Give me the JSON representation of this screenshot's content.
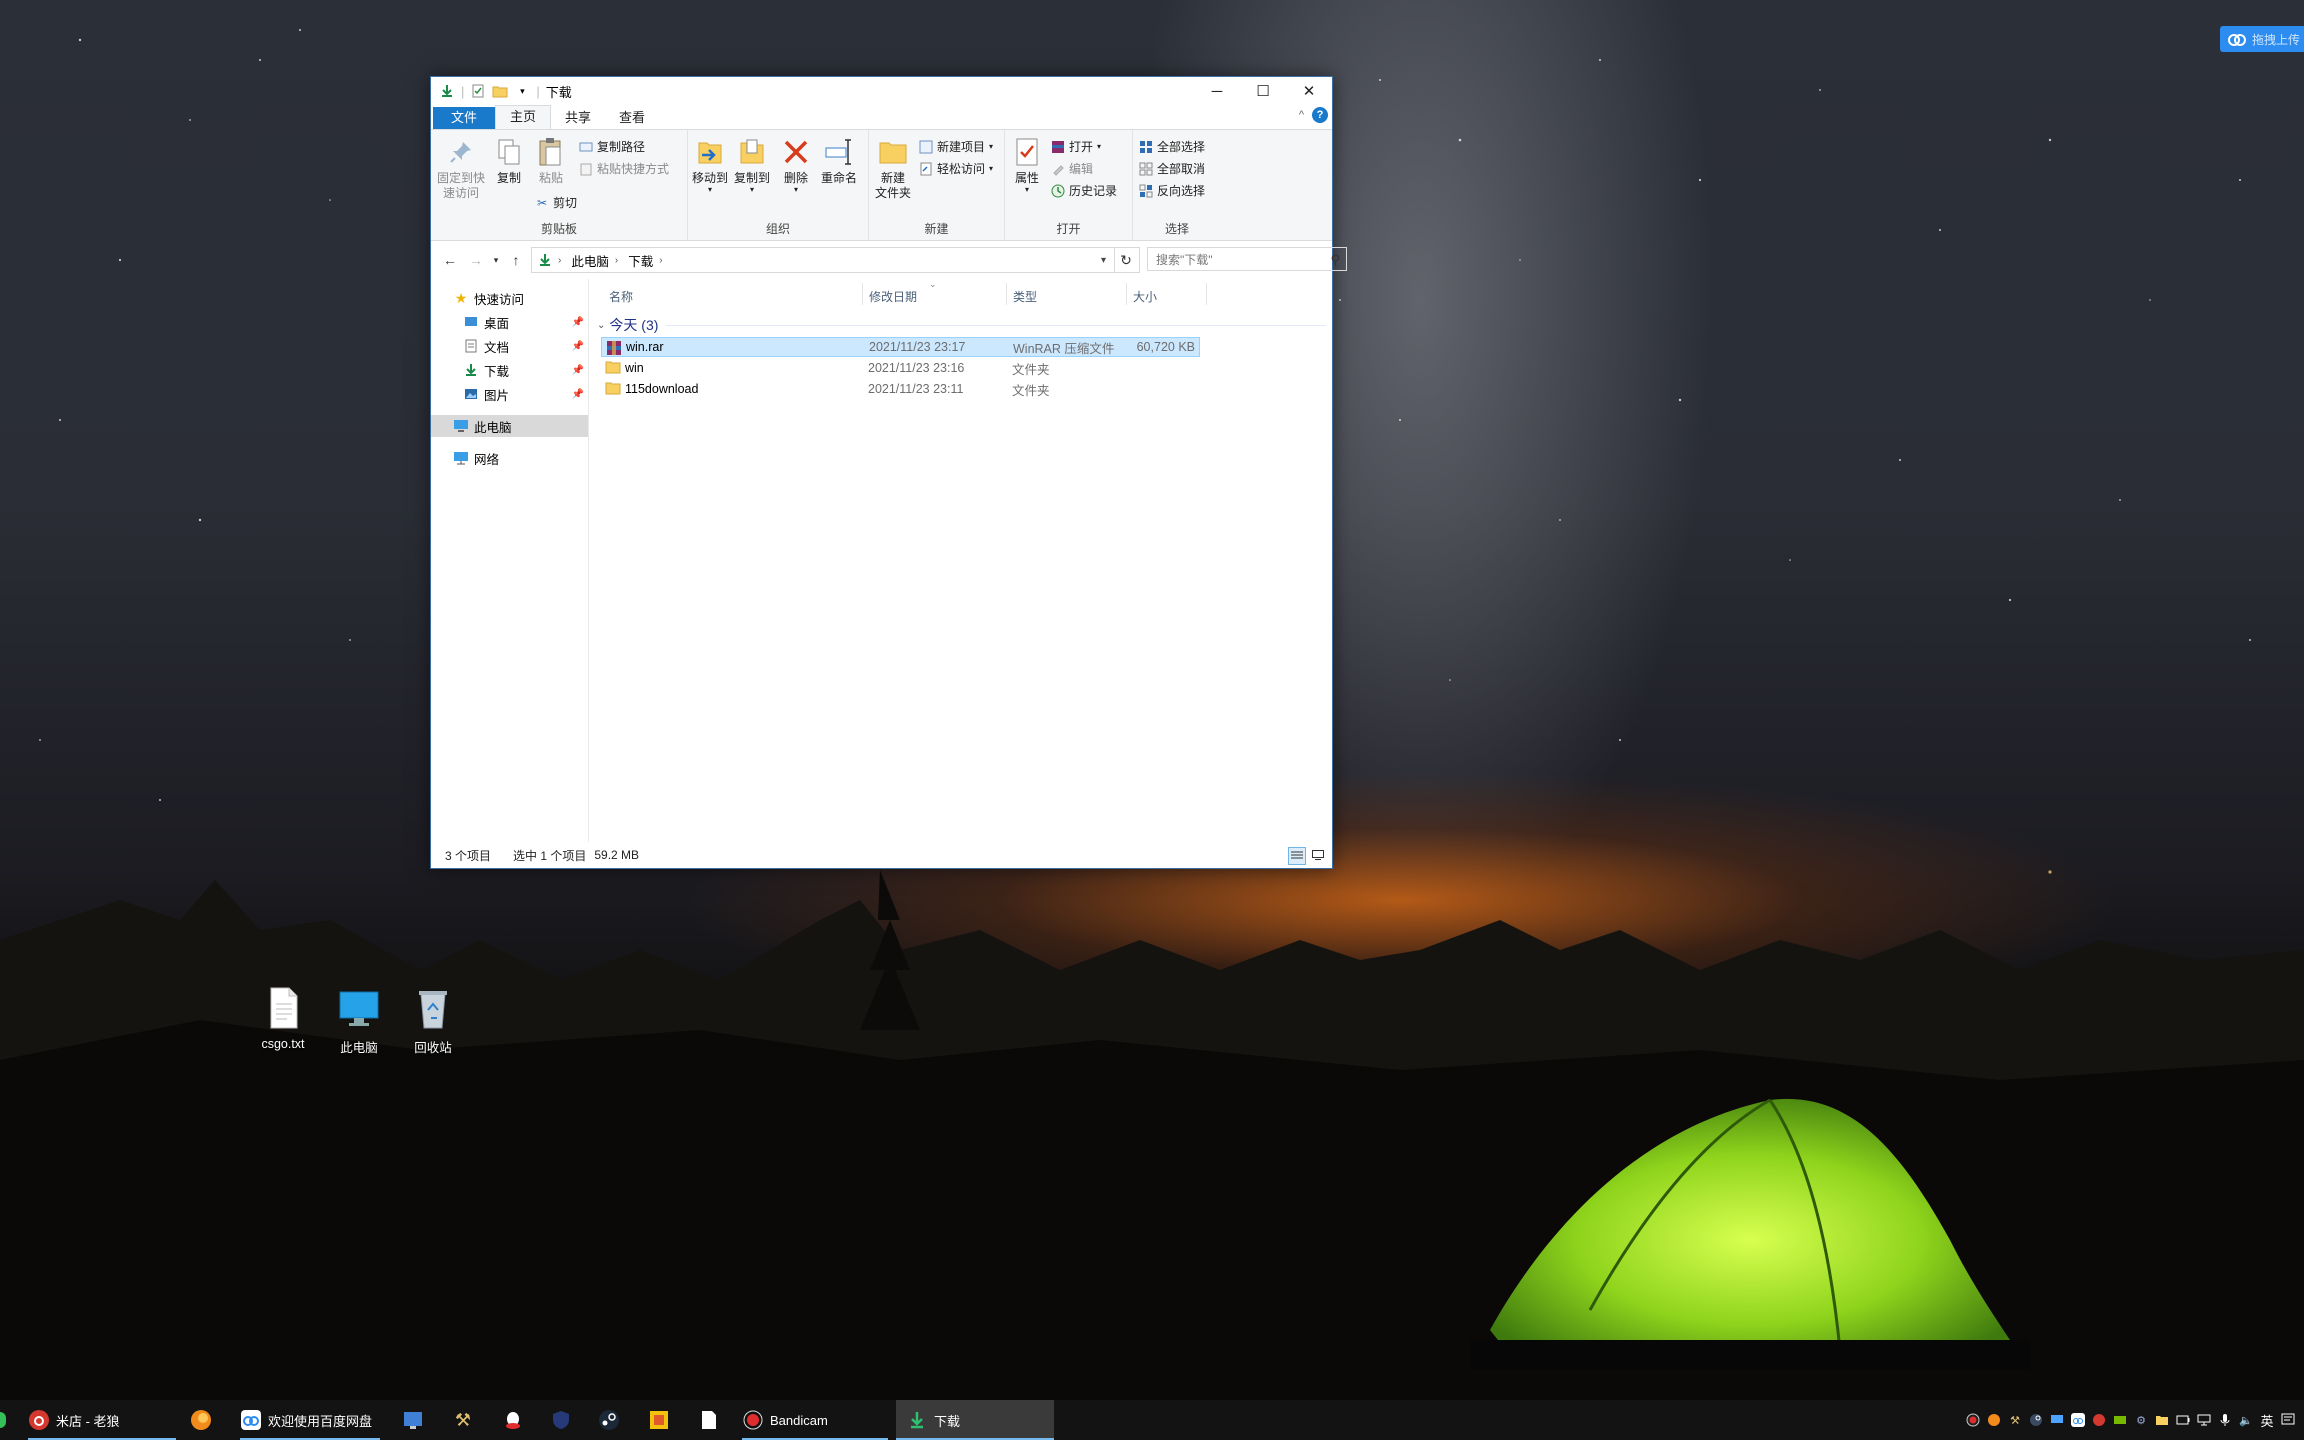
{
  "window": {
    "title": "下载",
    "tabs": {
      "file": "文件",
      "home": "主页",
      "share": "共享",
      "view": "查看"
    },
    "help_icon": "?"
  },
  "ribbon": {
    "clipboard": {
      "label": "剪贴板",
      "pin": "固定到快速访问",
      "copy": "复制",
      "paste": "粘贴",
      "copy_path": "复制路径",
      "paste_shortcut": "粘贴快捷方式",
      "cut": "剪切"
    },
    "organize": {
      "label": "组织",
      "move_to": "移动到",
      "copy_to": "复制到",
      "delete": "删除",
      "rename": "重命名"
    },
    "new": {
      "label": "新建",
      "new_folder": "新建\n文件夹",
      "new_item": "新建项目",
      "easy_access": "轻松访问"
    },
    "open": {
      "label": "打开",
      "properties": "属性",
      "open": "打开",
      "edit": "编辑",
      "history": "历史记录"
    },
    "select": {
      "label": "选择",
      "select_all": "全部选择",
      "select_none": "全部取消",
      "invert": "反向选择"
    }
  },
  "address": {
    "crumbs": [
      "此电脑",
      "下载"
    ],
    "search_placeholder": "搜索\"下载\""
  },
  "nav": {
    "quick_access": "快速访问",
    "items": [
      {
        "label": "桌面"
      },
      {
        "label": "文档"
      },
      {
        "label": "下载"
      },
      {
        "label": "图片"
      }
    ],
    "this_pc": "此电脑",
    "network": "网络"
  },
  "columns": {
    "name": "名称",
    "date": "修改日期",
    "type": "类型",
    "size": "大小"
  },
  "group": {
    "label": "今天 (3)"
  },
  "files": [
    {
      "name": "win.rar",
      "date": "2021/11/23 23:17",
      "type": "WinRAR 压缩文件",
      "size": "60,720 KB",
      "icon": "winrar-icon"
    },
    {
      "name": "win",
      "date": "2021/11/23 23:16",
      "type": "文件夹",
      "size": "",
      "icon": "folder-icon"
    },
    {
      "name": "115download",
      "date": "2021/11/23 23:11",
      "type": "文件夹",
      "size": "",
      "icon": "folder-icon"
    }
  ],
  "status": {
    "count": "3 个项目",
    "selected": "选中 1 个项目",
    "size": "59.2 MB"
  },
  "desktop": [
    {
      "label": "csgo.txt"
    },
    {
      "label": "此电脑"
    },
    {
      "label": "回收站"
    }
  ],
  "floating": {
    "label": "拖拽上传"
  },
  "taskbar": {
    "netease": "米店 - 老狼",
    "baidu": "欢迎使用百度网盘",
    "bandicam": "Bandicam",
    "explorer": "下载",
    "lang": "英"
  },
  "colors": {
    "accent": "#1979ca",
    "selection": "#cce8ff",
    "taskbar": "#131313"
  }
}
